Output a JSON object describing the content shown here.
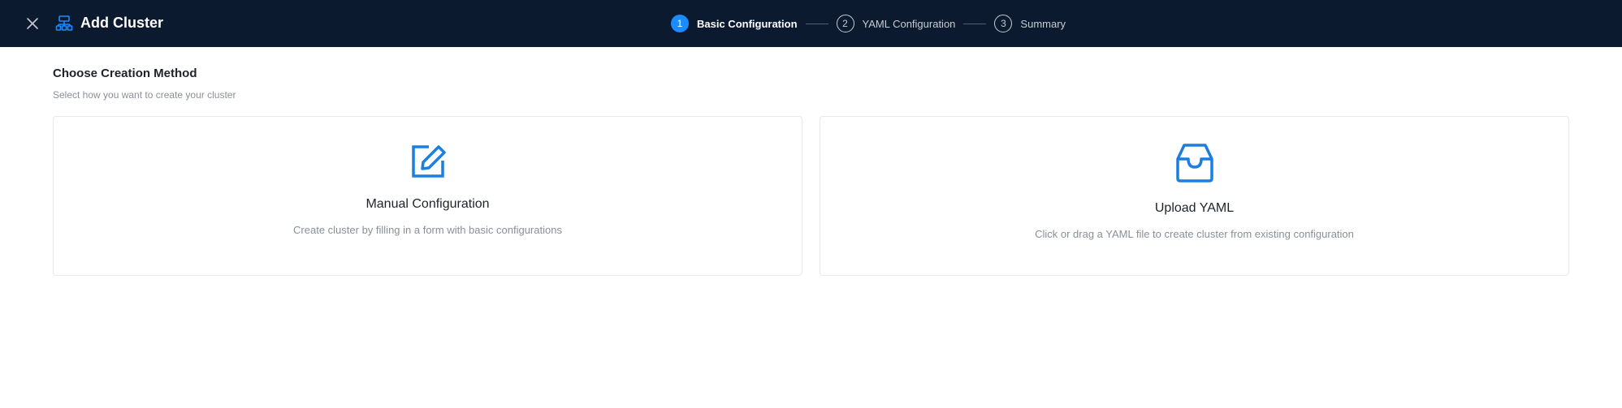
{
  "header": {
    "title": "Add Cluster",
    "close_icon": "close-icon",
    "title_icon": "cluster-icon"
  },
  "steps": [
    {
      "number": "1",
      "label": "Basic Configuration",
      "state": "active"
    },
    {
      "number": "2",
      "label": "YAML Configuration",
      "state": "inactive"
    },
    {
      "number": "3",
      "label": "Summary",
      "state": "inactive"
    }
  ],
  "main": {
    "section_title": "Choose Creation Method",
    "section_subtitle": "Select how you want to create your cluster",
    "cards": [
      {
        "icon": "edit-icon",
        "title": "Manual Configuration",
        "description": "Create cluster by filling in a form with basic configurations"
      },
      {
        "icon": "inbox-icon",
        "title": "Upload YAML",
        "description": "Click or drag a YAML file to create cluster from existing configuration"
      }
    ]
  },
  "colors": {
    "header_bg": "#0b1a2e",
    "accent": "#1a8cff",
    "icon_blue": "#1a7fe0"
  }
}
